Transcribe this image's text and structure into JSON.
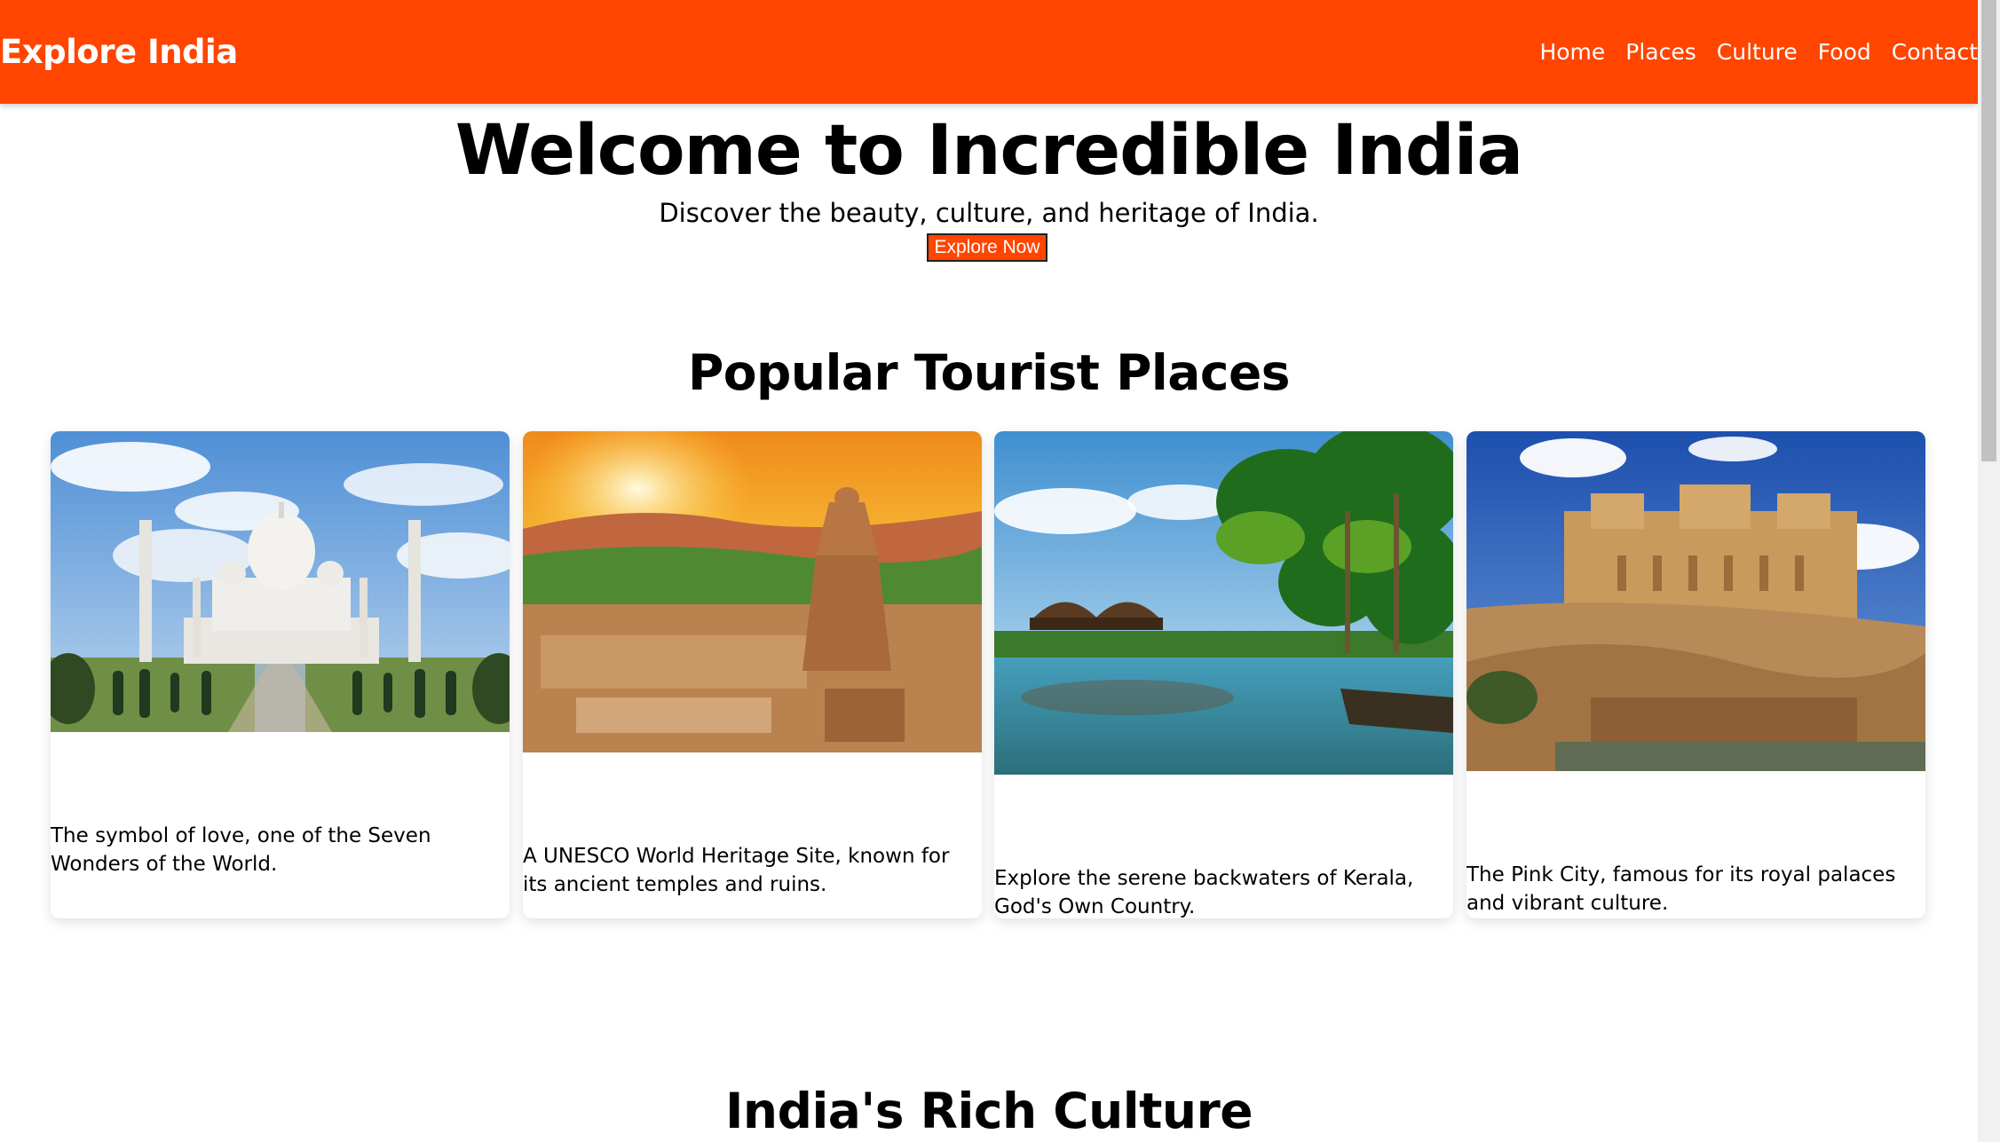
{
  "header": {
    "brand": "Explore India",
    "nav": [
      "Home",
      "Places",
      "Culture",
      "Food",
      "Contact"
    ]
  },
  "hero": {
    "title": "Welcome to Incredible India",
    "subtitle": "Discover the beauty, culture, and heritage of India.",
    "button": "Explore Now"
  },
  "places": {
    "title": "Popular Tourist Places",
    "cards": [
      {
        "image": "taj-mahal-photo",
        "description": "The symbol of love, one of the Seven Wonders of the World."
      },
      {
        "image": "hampi-temple-photo",
        "description": "A UNESCO World Heritage Site, known for its ancient temples and ruins."
      },
      {
        "image": "kerala-backwaters-photo",
        "description": "Explore the serene backwaters of Kerala, God's Own Country."
      },
      {
        "image": "jaipur-amber-fort-photo",
        "description": "The Pink City, famous for its royal palaces and vibrant culture."
      }
    ]
  },
  "culture": {
    "title": "India's Rich Culture"
  },
  "colors": {
    "accent": "#ff4500",
    "background": "#ffffff"
  }
}
